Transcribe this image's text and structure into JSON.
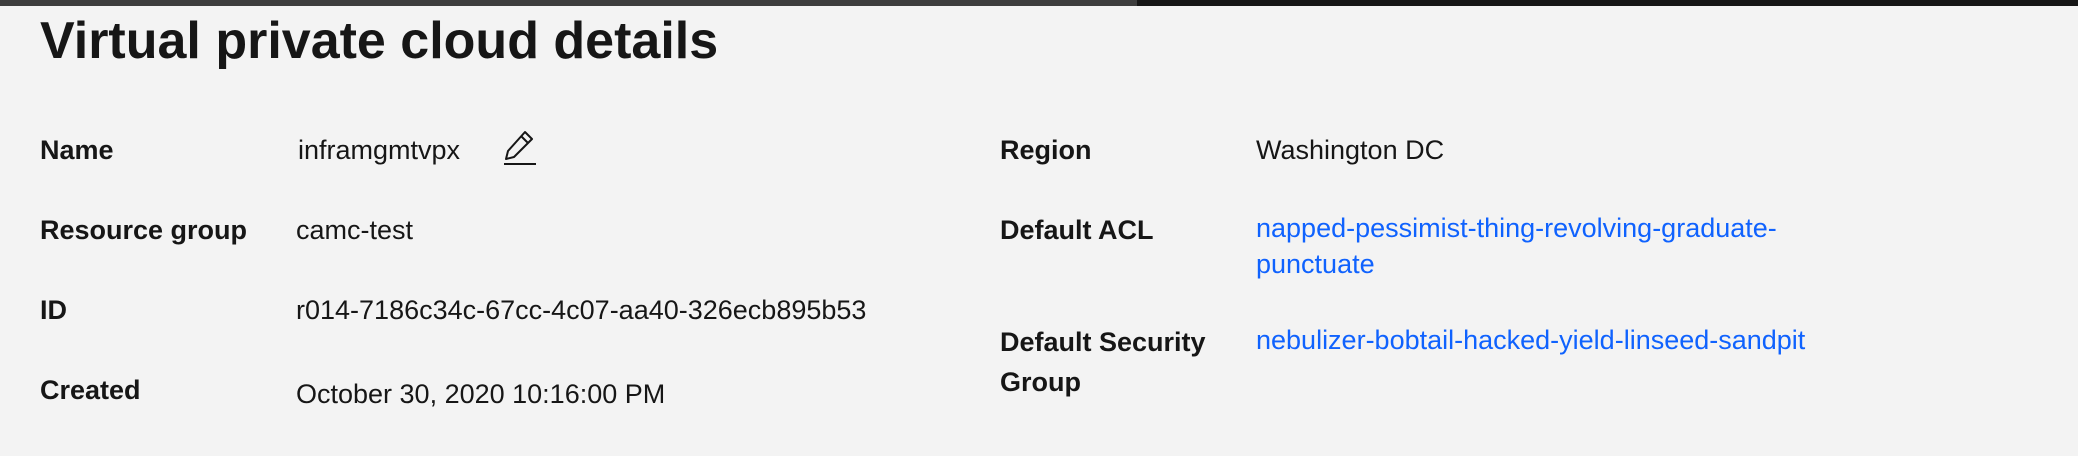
{
  "page": {
    "title": "Virtual private cloud details"
  },
  "details": {
    "name": {
      "label": "Name",
      "value": "inframgmtvpx",
      "edit_icon": "edit-pencil-icon"
    },
    "resource_group": {
      "label": "Resource group",
      "value": "camc-test"
    },
    "id": {
      "label": "ID",
      "value": "r014-7186c34c-67cc-4c07-aa40-326ecb895b53"
    },
    "created": {
      "label": "Created",
      "value": "October 30, 2020 10:16:00 PM"
    },
    "region": {
      "label": "Region",
      "value": "Washington DC"
    },
    "default_acl": {
      "label": "Default ACL",
      "value": "napped-pessimist-thing-revolving-graduate-punctuate"
    },
    "default_security_group": {
      "label": "Default Security Group",
      "value": "nebulizer-bobtail-hacked-yield-linseed-sandpit"
    }
  },
  "colors": {
    "background": "#f3f3f3",
    "text": "#161616",
    "link": "#0f62fe"
  }
}
